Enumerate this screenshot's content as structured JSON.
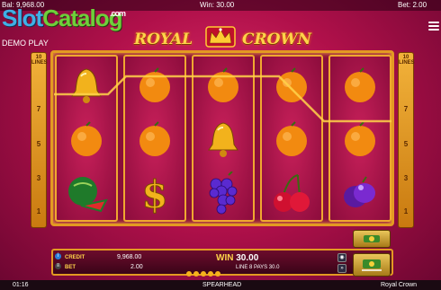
{
  "topbar": {
    "balance": "Bal: 9,968.00",
    "win": "Win: 30.00",
    "bet": "Bet: 2.00"
  },
  "watermark": {
    "part1": "Slot",
    "part2": "Catalog",
    "com": ".com"
  },
  "demo_label": "DEMO PLAY",
  "logo": {
    "left": "ROYAL",
    "right": "CROWN"
  },
  "lines_panel": {
    "header": "10 LINES",
    "numbers": [
      "7",
      "5",
      "3",
      "1"
    ]
  },
  "reels": [
    [
      "golden-bell",
      "orange",
      "watermelon"
    ],
    [
      "orange",
      "orange",
      "dollar-sign"
    ],
    [
      "orange",
      "golden-bell",
      "grapes"
    ],
    [
      "orange",
      "orange",
      "cherries"
    ],
    [
      "orange",
      "orange",
      "plums"
    ]
  ],
  "panel": {
    "credit_label": "CREDIT",
    "credit_value": "9,968.00",
    "bet_label": "BET",
    "bet_value": "2.00",
    "win_label": "WIN",
    "win_value": "30.00",
    "pays_text": "LINE 8 PAYS 30.0"
  },
  "footer": {
    "time": "01:16",
    "provider": "SPEARHEAD",
    "game": "Royal Crown"
  },
  "colors": {
    "gold": "#e39a22",
    "bg": "#b0104a"
  }
}
